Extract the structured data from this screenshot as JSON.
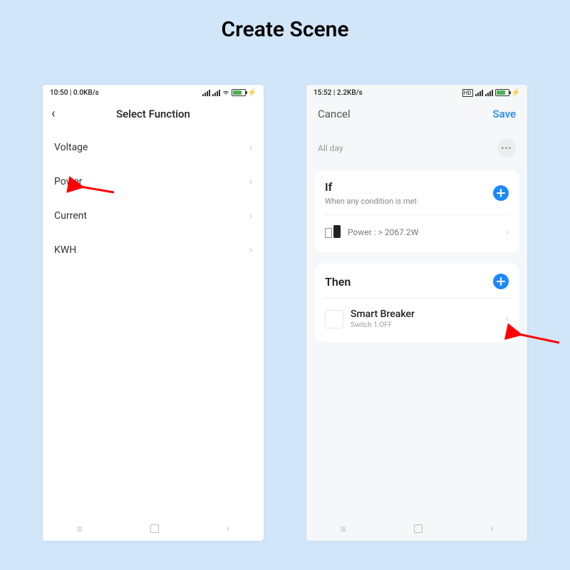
{
  "page_title": "Create Scene",
  "left": {
    "statusbar": {
      "time": "10:50",
      "net": "0.0KB/s"
    },
    "header": {
      "title": "Select Function"
    },
    "functions": [
      "Voltage",
      "Power",
      "Current",
      "KWH"
    ]
  },
  "right": {
    "statusbar": {
      "time": "15:52",
      "net": "2.2KB/s"
    },
    "header": {
      "cancel": "Cancel",
      "save": "Save"
    },
    "allday": "All day",
    "if_card": {
      "title": "If",
      "subtitle": "When any condition is met·",
      "condition": "Power : > 2067.2W"
    },
    "then_card": {
      "title": "Then",
      "device": "Smart Breaker",
      "action": "Switch 1:OFF"
    }
  }
}
